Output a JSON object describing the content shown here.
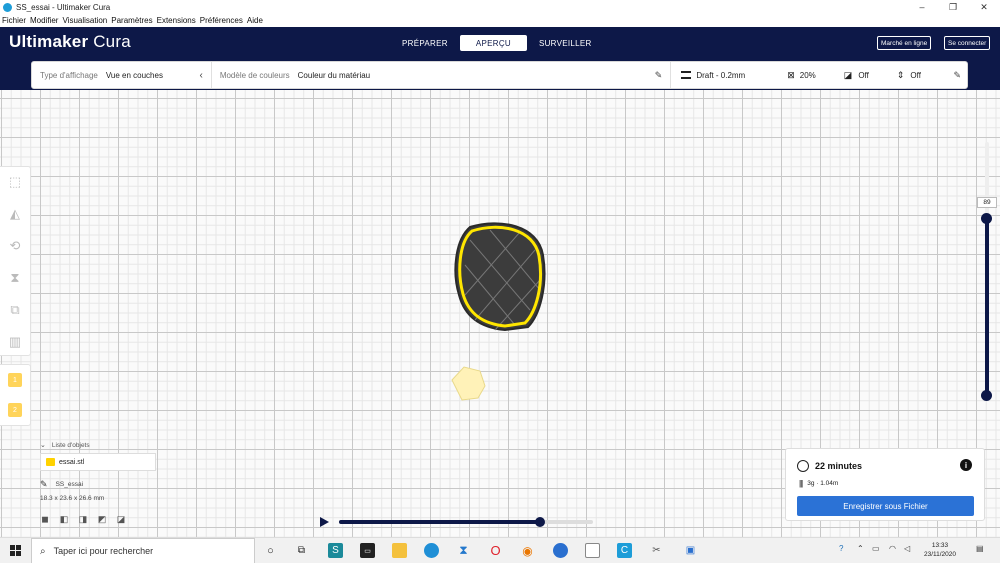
{
  "window": {
    "title": "SS_essai - Ultimaker Cura",
    "controls": {
      "minimize": "–",
      "maximize": "❐",
      "close": "✕"
    }
  },
  "menu": [
    "Fichier",
    "Modifier",
    "Visualisation",
    "Paramètres",
    "Extensions",
    "Préférences",
    "Aide"
  ],
  "header": {
    "brand_bold": "Ultimaker",
    "brand_light": " Cura",
    "stages": [
      {
        "label": "PRÉPARER",
        "active": false
      },
      {
        "label": "APERÇU",
        "active": true
      },
      {
        "label": "SURVEILLER",
        "active": false
      }
    ],
    "marketplace_label": "Marché en ligne",
    "signin_label": "Se connecter"
  },
  "view_settings": {
    "view_type_label": "Type d'affichage",
    "view_type_value": "Vue en couches",
    "color_scheme_label": "Modèle de couleurs",
    "color_scheme_value": "Couleur du matériau"
  },
  "print_setup": {
    "profile": "Draft - 0.2mm",
    "infill": "20%",
    "support": "Off",
    "adhesion": "Off"
  },
  "layer_view": {
    "current_layer": "89",
    "simulation_progress": 0.79
  },
  "objects": {
    "list_label": "Liste d'objets",
    "items": [
      "essai.stl"
    ],
    "job_name": "SS_essai",
    "dimensions": "18.3 x 23.6 x 26.6 mm"
  },
  "extruders": [
    "1",
    "2"
  ],
  "print_info": {
    "time": "22 minutes",
    "material": "3g · 1.04m",
    "save_button": "Enregistrer sous Fichier"
  },
  "taskbar": {
    "search_placeholder": "Taper ici pour rechercher",
    "time": "13:33",
    "date": "23/11/2020"
  },
  "colors": {
    "header_bg": "#0d1848",
    "accent_blue": "#2b72d6",
    "material_yellow": "#ffd200"
  }
}
